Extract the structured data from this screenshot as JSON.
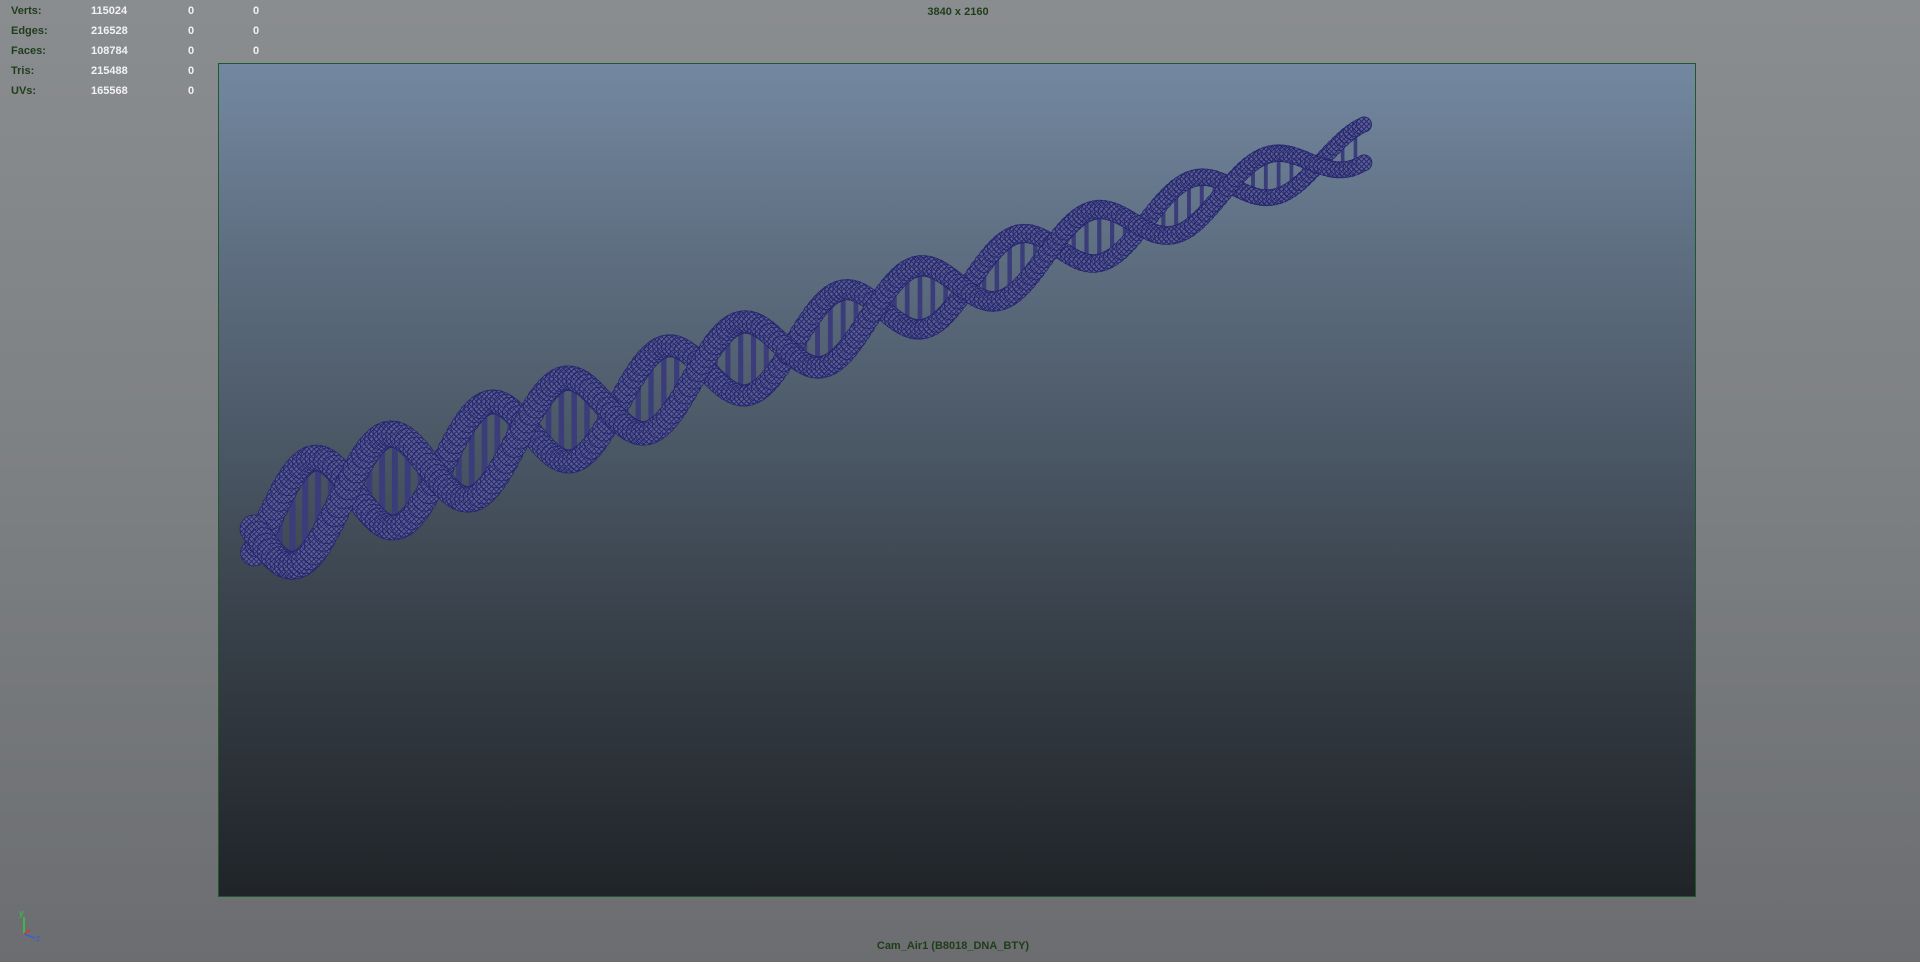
{
  "hud": {
    "rows": [
      {
        "label": "Verts:",
        "total": "115024",
        "selected": "0",
        "components": "0"
      },
      {
        "label": "Edges:",
        "total": "216528",
        "selected": "0",
        "components": "0"
      },
      {
        "label": "Faces:",
        "total": "108784",
        "selected": "0",
        "components": "0"
      },
      {
        "label": "Tris:",
        "total": "215488",
        "selected": "0",
        "components": "0"
      },
      {
        "label": "UVs:",
        "total": "165568",
        "selected": "0",
        "components": "0"
      }
    ]
  },
  "viewport": {
    "resolution": "3840 x 2160",
    "camera": "Cam_Air1 (B8018_DNA_BTY)"
  },
  "axis": {
    "y_label": "y",
    "z_label": "z"
  },
  "colors": {
    "hud_label": "#1f3d1a",
    "hud_value": "#f2f2f2",
    "gate_border": "#1c5a2c",
    "wireframe": "#24256e",
    "wireframe_fill": "#5a5e8e"
  },
  "icons": {
    "axis": "view-axis-icon"
  }
}
